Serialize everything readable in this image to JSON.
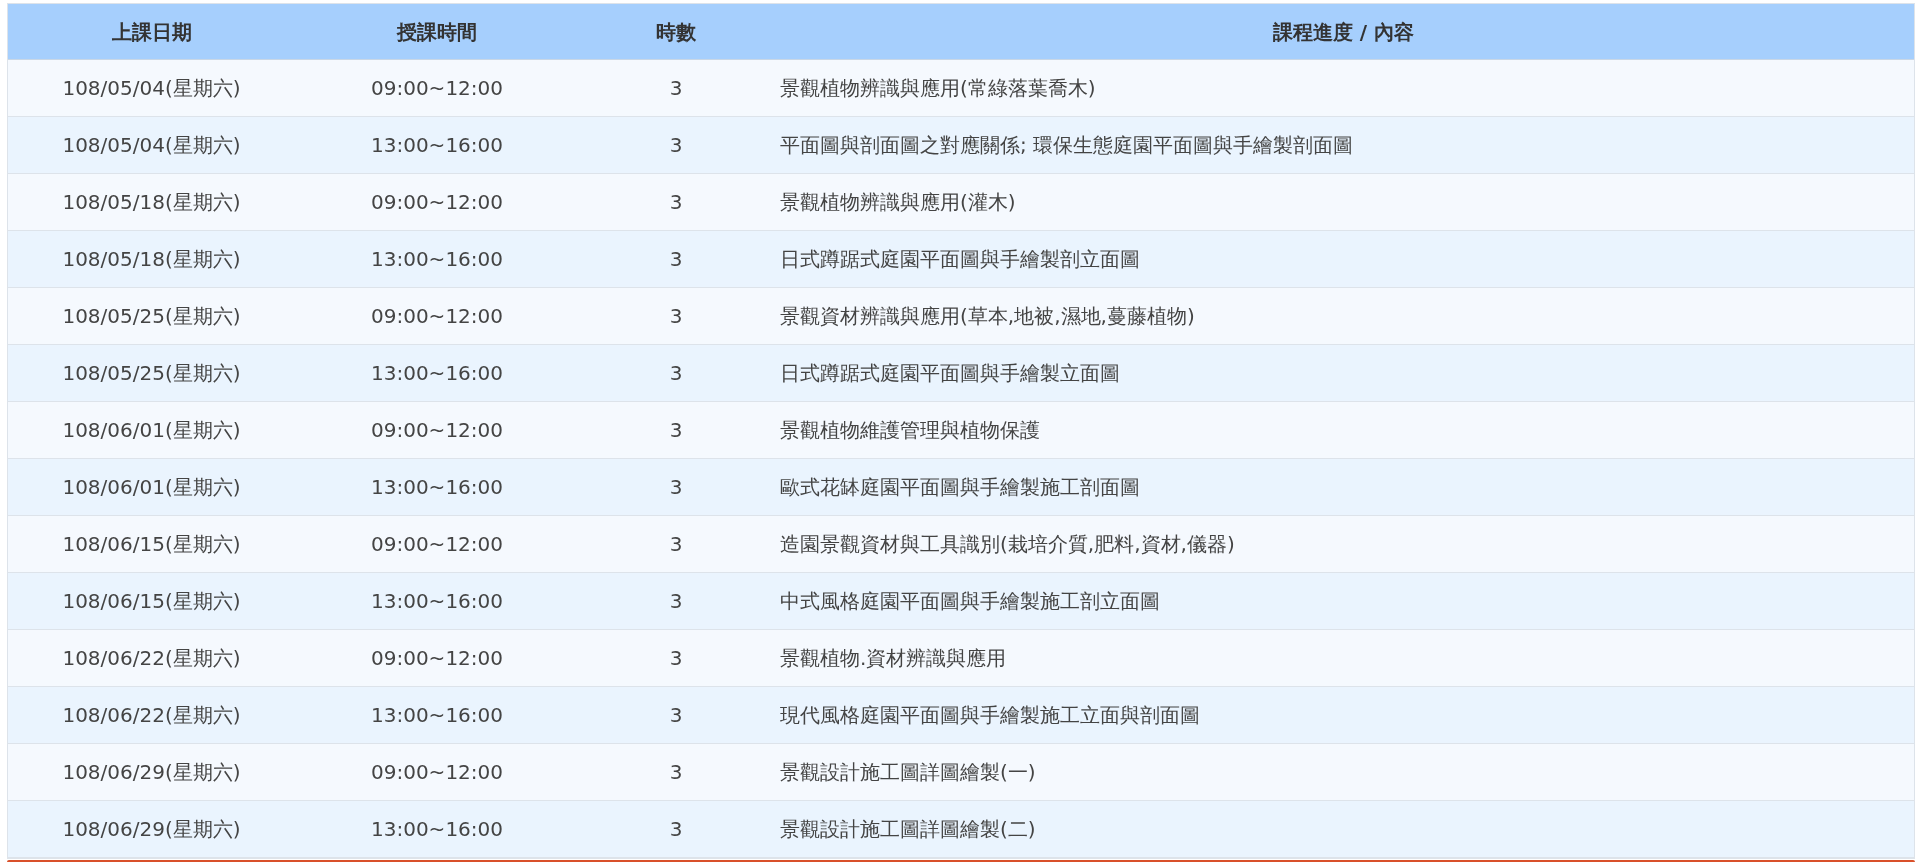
{
  "table": {
    "columns": [
      "上課日期",
      "授課時間",
      "時數",
      "課程進度 / 內容"
    ],
    "rows": [
      [
        "108/05/04(星期六)",
        "09:00~12:00",
        "3",
        "景觀植物辨識與應用(常綠落葉喬木)"
      ],
      [
        "108/05/04(星期六)",
        "13:00~16:00",
        "3",
        "平面圖與剖面圖之對應關係; 環保生態庭園平面圖與手繪製剖面圖"
      ],
      [
        "108/05/18(星期六)",
        "09:00~12:00",
        "3",
        "景觀植物辨識與應用(灌木)"
      ],
      [
        "108/05/18(星期六)",
        "13:00~16:00",
        "3",
        "日式蹲踞式庭園平面圖與手繪製剖立面圖"
      ],
      [
        "108/05/25(星期六)",
        "09:00~12:00",
        "3",
        "景觀資材辨識與應用(草本,地被,濕地,蔓藤植物)"
      ],
      [
        "108/05/25(星期六)",
        "13:00~16:00",
        "3",
        "日式蹲踞式庭園平面圖與手繪製立面圖"
      ],
      [
        "108/06/01(星期六)",
        "09:00~12:00",
        "3",
        "景觀植物維護管理與植物保護"
      ],
      [
        "108/06/01(星期六)",
        "13:00~16:00",
        "3",
        "歐式花缽庭園平面圖與手繪製施工剖面圖"
      ],
      [
        "108/06/15(星期六)",
        "09:00~12:00",
        "3",
        "造園景觀資材與工具識別(栽培介質,肥料,資材,儀器)"
      ],
      [
        "108/06/15(星期六)",
        "13:00~16:00",
        "3",
        "中式風格庭園平面圖與手繪製施工剖立面圖"
      ],
      [
        "108/06/22(星期六)",
        "09:00~12:00",
        "3",
        "景觀植物.資材辨識與應用"
      ],
      [
        "108/06/22(星期六)",
        "13:00~16:00",
        "3",
        "現代風格庭園平面圖與手繪製施工立面與剖面圖"
      ],
      [
        "108/06/29(星期六)",
        "09:00~12:00",
        "3",
        "景觀設計施工圖詳圖繪製(一)"
      ],
      [
        "108/06/29(星期六)",
        "13:00~16:00",
        "3",
        "景觀設計施工圖詳圖繪製(二)"
      ]
    ]
  }
}
